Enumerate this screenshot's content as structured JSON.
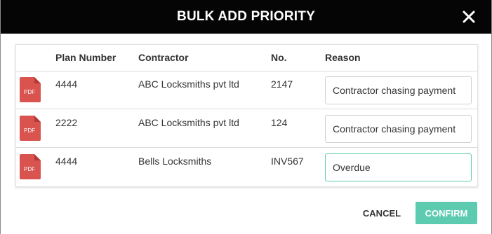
{
  "modal": {
    "title": "BULK ADD PRIORITY",
    "close_icon": "close-icon"
  },
  "table": {
    "headers": {
      "plan_number": "Plan Number",
      "contractor": "Contractor",
      "no": "No.",
      "reason": "Reason"
    },
    "rows": [
      {
        "icon": "pdf-file-icon",
        "icon_label": "PDF",
        "plan_number": "4444",
        "contractor": "ABC Locksmiths pvt ltd",
        "no": "2147",
        "reason": "Contractor chasing payment"
      },
      {
        "icon": "pdf-file-icon",
        "icon_label": "PDF",
        "plan_number": "2222",
        "contractor": "ABC Locksmiths pvt ltd",
        "no": "124",
        "reason": "Contractor chasing payment"
      },
      {
        "icon": "pdf-file-icon",
        "icon_label": "PDF",
        "plan_number": "4444",
        "contractor": "Bells Locksmiths",
        "no": "INV567",
        "reason": "Overdue"
      }
    ]
  },
  "actions": {
    "cancel_label": "CANCEL",
    "confirm_label": "CONFIRM"
  },
  "colors": {
    "header_bg": "#050505",
    "accent": "#5ccbb0",
    "pdf_red": "#d9534f"
  }
}
